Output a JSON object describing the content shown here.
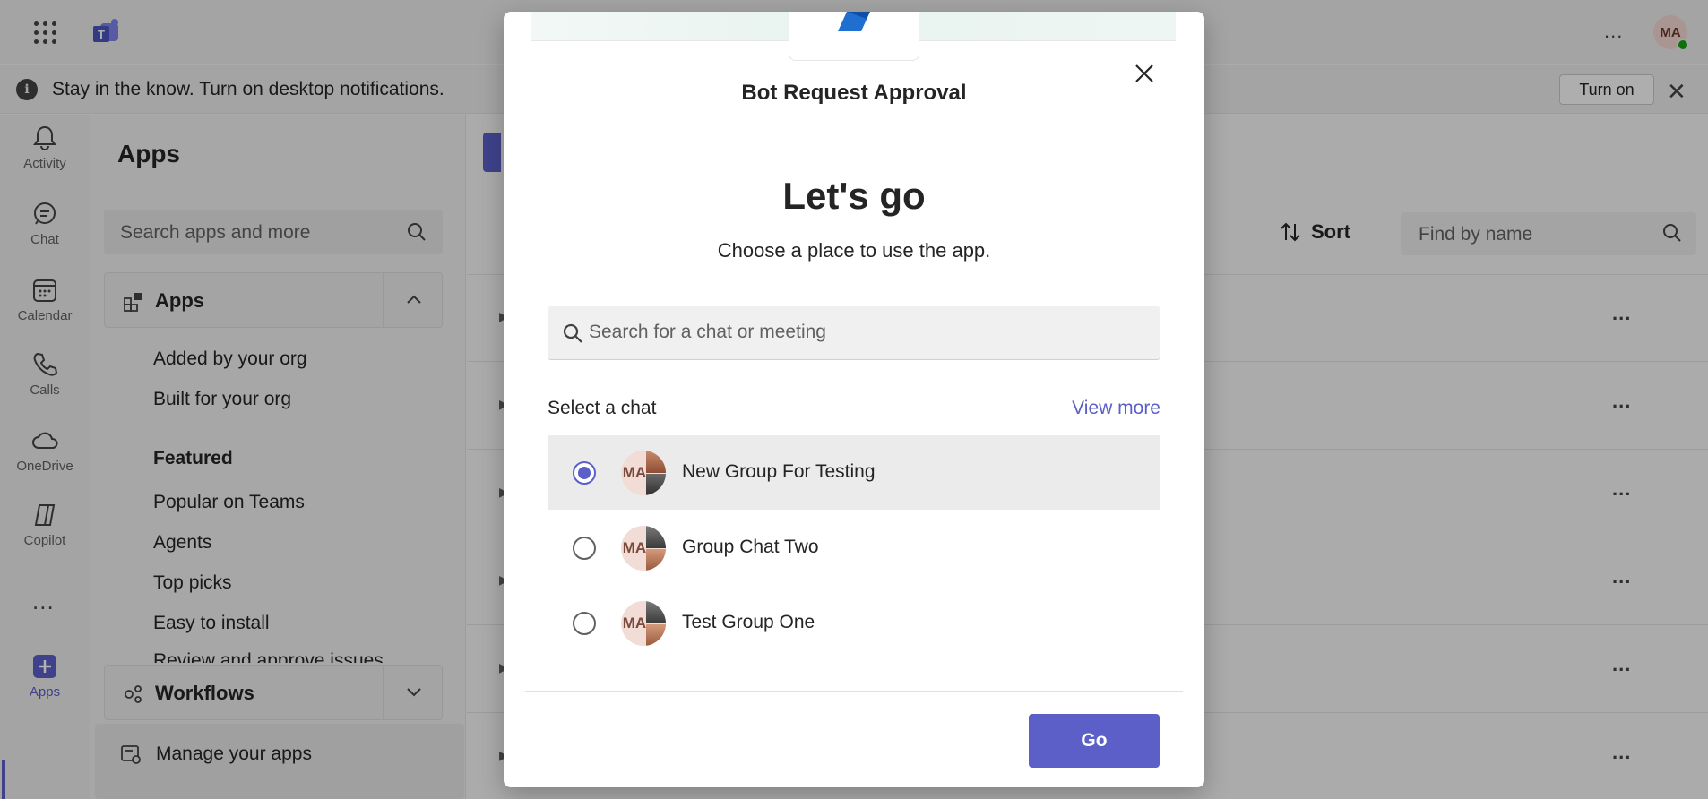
{
  "header": {
    "avatar_initials": "MA",
    "more_label": "..."
  },
  "notification": {
    "text": "Stay in the know. Turn on desktop notifications.",
    "turn_on_label": "Turn on"
  },
  "rail": {
    "items": [
      {
        "label": "Activity",
        "icon": "bell-icon"
      },
      {
        "label": "Chat",
        "icon": "chat-icon"
      },
      {
        "label": "Calendar",
        "icon": "calendar-icon"
      },
      {
        "label": "Calls",
        "icon": "phone-icon"
      },
      {
        "label": "OneDrive",
        "icon": "cloud-icon"
      },
      {
        "label": "Copilot",
        "icon": "copilot-icon"
      },
      {
        "label": "Apps",
        "icon": "plus-square-icon",
        "active": true
      }
    ],
    "more": "..."
  },
  "apps_panel": {
    "title": "Apps",
    "search_placeholder": "Search apps and more",
    "apps_section": {
      "title": "Apps",
      "links": [
        "Added by your org",
        "Built for your org"
      ],
      "featured_title": "Featured",
      "featured_links": [
        "Popular on Teams",
        "Agents",
        "Top picks",
        "Easy to install",
        "Review and approve issues"
      ]
    },
    "workflows_section": {
      "title": "Workflows"
    },
    "manage_label": "Manage your apps"
  },
  "main": {
    "sort_label": "Sort",
    "find_placeholder": "Find by name",
    "row_more": "..."
  },
  "dialog": {
    "app_name": "Bot Request Approval",
    "title": "Let's go",
    "subtitle": "Choose a place to use the app.",
    "search_placeholder": "Search for a chat or meeting",
    "select_label": "Select a chat",
    "view_more_label": "View more",
    "chats": [
      {
        "name": "New Group For Testing",
        "initials": "MA",
        "selected": true
      },
      {
        "name": "Group Chat Two",
        "initials": "MA",
        "selected": false
      },
      {
        "name": "Test Group One",
        "initials": "MA",
        "selected": false
      }
    ],
    "go_label": "Go"
  },
  "colors": {
    "accent": "#5b5fc7",
    "presence": "#13a10e"
  }
}
